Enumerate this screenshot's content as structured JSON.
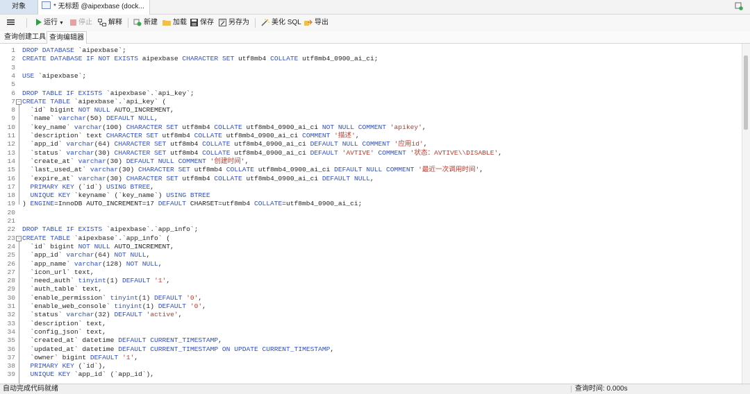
{
  "tabs": {
    "objects_label": "对象",
    "document_label": "* 无标题 @aipexbase (dock..."
  },
  "toolbar": {
    "run_label": "运行",
    "stop_label": "停止",
    "explain_label": "解释",
    "new_label": "新建",
    "load_label": "加载",
    "save_label": "保存",
    "save_as_label": "另存为",
    "beautify_label": "美化 SQL",
    "export_label": "导出"
  },
  "subtabs": {
    "builder_label": "查询创建工具",
    "editor_label": "查询编辑器"
  },
  "status": {
    "left_text": "自动完成代码就绪",
    "right_text": "查询时间: 0.000s"
  },
  "colors": {
    "keyword": "#3050c8",
    "string": "#c0392b",
    "selected_tab": "#d9e4f2"
  },
  "editor": {
    "lines": [
      "DROP DATABASE `aipexbase`;",
      "CREATE DATABASE IF NOT EXISTS aipexbase CHARACTER SET utf8mb4 COLLATE utf8mb4_0900_ai_ci;",
      "",
      "USE `aipexbase`;",
      "",
      "DROP TABLE IF EXISTS `aipexbase`.`api_key`;",
      "CREATE TABLE `aipexbase`.`api_key` (",
      "  `id` bigint NOT NULL AUTO_INCREMENT,",
      "  `name` varchar(50) DEFAULT NULL,",
      "  `key_name` varchar(100) CHARACTER SET utf8mb4 COLLATE utf8mb4_0900_ai_ci NOT NULL COMMENT 'apikey',",
      "  `description` text CHARACTER SET utf8mb4 COLLATE utf8mb4_0900_ai_ci COMMENT '描述',",
      "  `app_id` varchar(64) CHARACTER SET utf8mb4 COLLATE utf8mb4_0900_ai_ci DEFAULT NULL COMMENT '应用id',",
      "  `status` varchar(30) CHARACTER SET utf8mb4 COLLATE utf8mb4_0900_ai_ci DEFAULT 'AVTIVE' COMMENT '状态：AVTIVE\\\\DISABLE',",
      "  `create_at` varchar(30) DEFAULT NULL COMMENT '创建时间',",
      "  `last_used_at` varchar(30) CHARACTER SET utf8mb4 COLLATE utf8mb4_0900_ai_ci DEFAULT NULL COMMENT '最近一次调用时间',",
      "  `expire_at` varchar(30) CHARACTER SET utf8mb4 COLLATE utf8mb4_0900_ai_ci DEFAULT NULL,",
      "  PRIMARY KEY (`id`) USING BTREE,",
      "  UNIQUE KEY `keyname` (`key_name`) USING BTREE",
      ") ENGINE=InnoDB AUTO_INCREMENT=17 DEFAULT CHARSET=utf8mb4 COLLATE=utf8mb4_0900_ai_ci;",
      "",
      "",
      "DROP TABLE IF EXISTS `aipexbase`.`app_info`;",
      "CREATE TABLE `aipexbase`.`app_info` (",
      "  `id` bigint NOT NULL AUTO_INCREMENT,",
      "  `app_id` varchar(64) NOT NULL,",
      "  `app_name` varchar(128) NOT NULL,",
      "  `icon_url` text,",
      "  `need_auth` tinyint(1) DEFAULT '1',",
      "  `auth_table` text,",
      "  `enable_permission` tinyint(1) DEFAULT '0',",
      "  `enable_web_console` tinyint(1) DEFAULT '0',",
      "  `status` varchar(32) DEFAULT 'active',",
      "  `description` text,",
      "  `config_json` text,",
      "  `created_at` datetime DEFAULT CURRENT_TIMESTAMP,",
      "  `updated_at` datetime DEFAULT CURRENT_TIMESTAMP ON UPDATE CURRENT_TIMESTAMP,",
      "  `owner` bigint DEFAULT '1',",
      "  PRIMARY KEY (`id`),",
      "  UNIQUE KEY `app_id` (`app_id`),"
    ]
  }
}
